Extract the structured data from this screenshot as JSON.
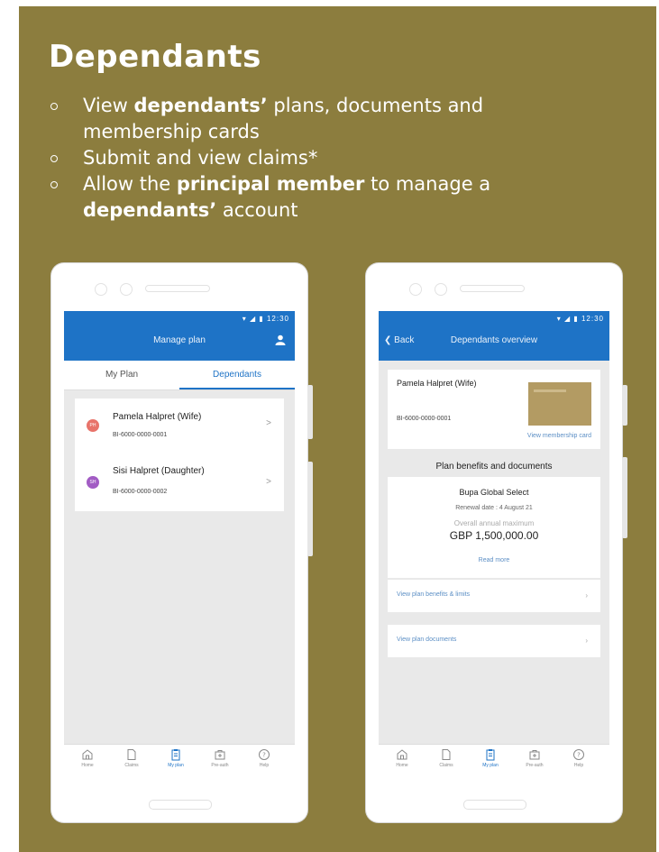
{
  "slide": {
    "title": "Dependants",
    "bullets": [
      {
        "segments": [
          {
            "t": "View ",
            "b": false
          },
          {
            "t": "dependants’",
            "b": true
          },
          {
            "t": " plans, documents and membership cards",
            "b": false
          }
        ]
      },
      {
        "segments": [
          {
            "t": "Submit and view claims*",
            "b": false
          }
        ]
      },
      {
        "segments": [
          {
            "t": "Allow the ",
            "b": false
          },
          {
            "t": "principal member",
            "b": true
          },
          {
            "t": " to manage a ",
            "b": false
          },
          {
            "t": "dependants’",
            "b": true
          },
          {
            "t": " account",
            "b": false
          }
        ]
      }
    ]
  },
  "colors": {
    "panel": "#8c7d3e",
    "appbar": "#1e73c6",
    "avatar_pamela": "#e8736a",
    "avatar_sisi": "#a25cc4"
  },
  "status_time": "12:30",
  "phone1": {
    "title": "Manage plan",
    "tabs": [
      "My Plan",
      "Dependants"
    ],
    "active_tab": 1,
    "dependants": [
      {
        "initials": "PH",
        "name": "Pamela Halpret (Wife)",
        "id": "BI-6000-0000-0001"
      },
      {
        "initials": "SH",
        "name": "Sisi Halpret (Daughter)",
        "id": "BI-6000-0000-0002"
      }
    ]
  },
  "phone2": {
    "back_label": "Back",
    "title": "Dependants overview",
    "card": {
      "name": "Pamela Halpret (Wife)",
      "id": "BI-6000-0000-0001",
      "link": "View membership card"
    },
    "section_title": "Plan benefits and documents",
    "plan": {
      "name": "Bupa Global Select",
      "renewal": "Renewal date : 4 August 21",
      "overall_label": "Overall annual maximum",
      "amount": "GBP 1,500,000.00",
      "read_more": "Read more"
    },
    "links": [
      "View plan benefits & limits",
      "View plan documents"
    ]
  },
  "nav": [
    {
      "icon": "home-icon",
      "label": "Home"
    },
    {
      "icon": "claims-icon",
      "label": "Claims"
    },
    {
      "icon": "my-plan-icon",
      "label": "My plan"
    },
    {
      "icon": "pre-auth-icon",
      "label": "Pre-auth"
    },
    {
      "icon": "help-icon",
      "label": "Help"
    }
  ],
  "active_nav": 2
}
